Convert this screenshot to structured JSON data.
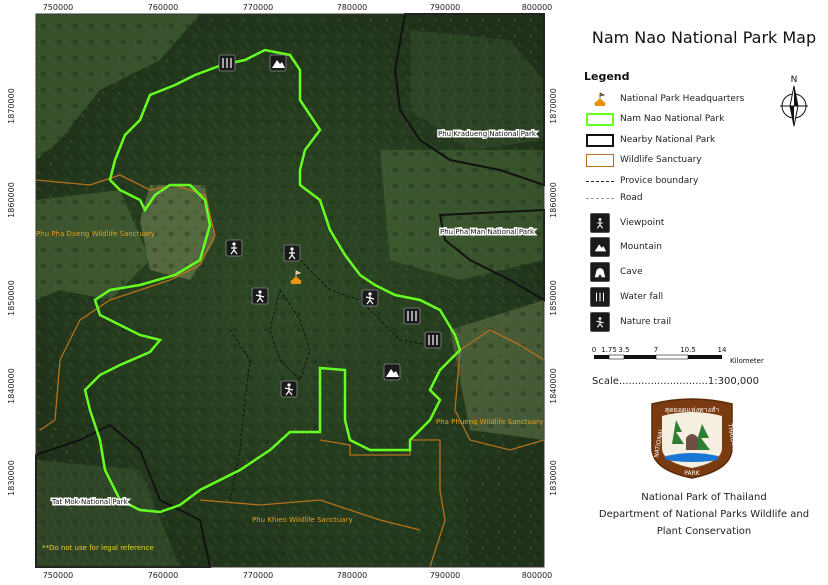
{
  "title": "Nam Nao National Park Map",
  "legend": {
    "title": "Legend",
    "items": [
      {
        "label": "National Park Headquarters",
        "kind": "hq",
        "color": "#e8920e"
      },
      {
        "label": "Nam Nao National Park",
        "kind": "box",
        "color": "#66ff22"
      },
      {
        "label": "Nearby National Park",
        "kind": "box",
        "color": "#111111"
      },
      {
        "label": "Wildlife Sanctuary",
        "kind": "box",
        "color": "#b5711c"
      },
      {
        "label": "Provice boundary",
        "kind": "dash",
        "color": "#222222"
      },
      {
        "label": "Road",
        "kind": "dashdot",
        "color": "#9a9a9a"
      },
      {
        "label": "Viewpoint",
        "kind": "icon",
        "icon": "viewpoint-icon"
      },
      {
        "label": "Mountain",
        "kind": "icon",
        "icon": "mountain-icon"
      },
      {
        "label": "Cave",
        "kind": "icon",
        "icon": "cave-icon"
      },
      {
        "label": "Water fall",
        "kind": "icon",
        "icon": "waterfall-icon"
      },
      {
        "label": "Nature trail",
        "kind": "icon",
        "icon": "nature-trail-icon"
      }
    ]
  },
  "north_arrow": {
    "label": "N"
  },
  "scale_bar": {
    "ticks": [
      "0",
      "1.75",
      "3.5",
      "7",
      "10.5",
      "14"
    ],
    "unit": "Kilometer"
  },
  "scale_text": "Scale............................1:300,000",
  "logo": {
    "text_top": "สุดยอดแห่งทางสำ",
    "text_left": "NATIONAL",
    "text_bottom": "PARK",
    "text_right": "THAILAND"
  },
  "credit": {
    "line1": "National Park of Thailand",
    "line2": "Department of National Parks Wildlife and",
    "line3": "Plant Conservation"
  },
  "axes": {
    "x_ticks": [
      "750000",
      "760000",
      "770000",
      "780000",
      "790000",
      "800000"
    ],
    "y_ticks": [
      "1870000",
      "1860000",
      "1850000",
      "1840000",
      "1830000"
    ]
  },
  "map_labels": {
    "phu_kradueng": "Phu Kradueng National Park",
    "phu_pha_man": "Phu Pha Man National Park",
    "phu_pha_daeng": "Phu Pha Daeng Wildlife Sanctuary",
    "pha_phueng": "Pha Phueng Wildlife Sanctuary",
    "tat_mok": "Tat Mok National Park",
    "phu_khieo": "Phu Khieo Wildlife Sanctuary",
    "disclaimer": "**Do not use for legal reference"
  },
  "colors": {
    "park_boundary": "#66ff22",
    "nearby_park": "#111111",
    "sanctuary": "#b5711c",
    "sanctuary_label": "#e8a020",
    "hq": "#e8920e",
    "terrain_dark": "#23361f"
  }
}
